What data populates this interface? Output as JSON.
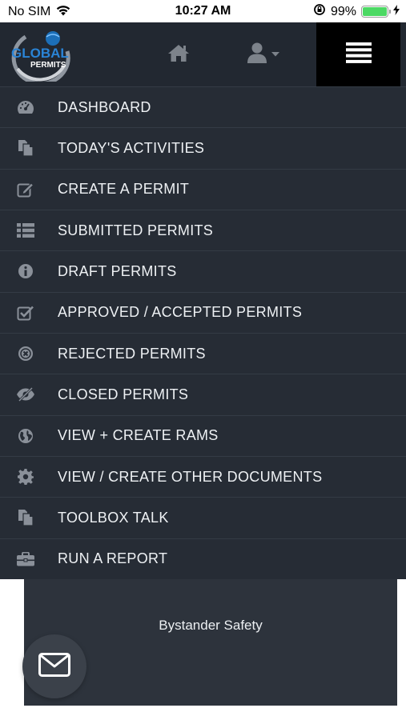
{
  "status_bar": {
    "carrier": "No SIM",
    "time": "10:27 AM",
    "battery_percent": "99%",
    "battery_level": 0.99,
    "icons": [
      "wifi-icon",
      "lock-rotation-icon",
      "battery-icon",
      "charging-bolt-icon"
    ]
  },
  "header": {
    "logo_text_top": "GLOBAL",
    "logo_text_bottom": "PERMITS",
    "icons": [
      "home-icon",
      "user-icon",
      "caret-down-icon",
      "hamburger-menu-icon"
    ],
    "menu_button_color": "#000000",
    "background_color": "#222831"
  },
  "menu": {
    "items": [
      {
        "label": "DASHBOARD",
        "icon": "dashboard-gauge-icon"
      },
      {
        "label": "TODAY'S ACTIVITIES",
        "icon": "copy-documents-icon"
      },
      {
        "label": "CREATE A PERMIT",
        "icon": "edit-icon"
      },
      {
        "label": "SUBMITTED PERMITS",
        "icon": "list-icon"
      },
      {
        "label": "DRAFT PERMITS",
        "icon": "info-circle-icon"
      },
      {
        "label": "APPROVED / ACCEPTED PERMITS",
        "icon": "check-square-icon"
      },
      {
        "label": "REJECTED PERMITS",
        "icon": "times-circle-icon"
      },
      {
        "label": "CLOSED PERMITS",
        "icon": "eye-slash-icon"
      },
      {
        "label": "VIEW + CREATE RAMS",
        "icon": "globe-icon"
      },
      {
        "label": "VIEW / CREATE OTHER DOCUMENTS",
        "icon": "gear-icon"
      },
      {
        "label": "TOOLBOX TALK",
        "icon": "copy-documents-icon"
      },
      {
        "label": "RUN A REPORT",
        "icon": "briefcase-icon"
      }
    ]
  },
  "content": {
    "card_text": "Bystander Safety"
  },
  "fab": {
    "icon": "envelope-icon"
  }
}
